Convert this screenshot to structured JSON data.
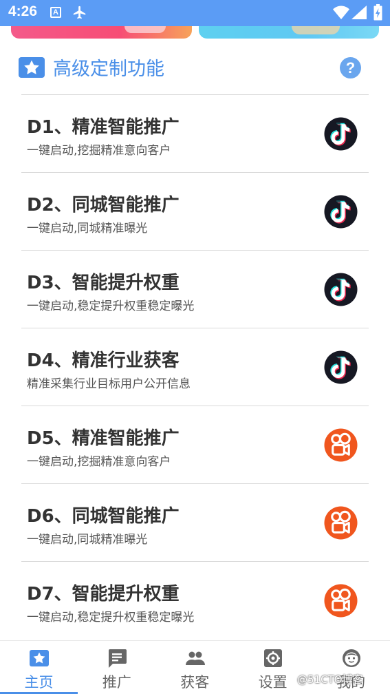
{
  "status_bar": {
    "time": "4:26",
    "a_badge": "A"
  },
  "section": {
    "title": "高级定制功能",
    "help": "?"
  },
  "items": [
    {
      "title": "D1、精准智能推广",
      "subtitle": "一键启动,挖掘精准意向客户",
      "icon": "tiktok-icon"
    },
    {
      "title": "D2、同城智能推广",
      "subtitle": "一键启动,同城精准曝光",
      "icon": "tiktok-icon"
    },
    {
      "title": "D3、智能提升权重",
      "subtitle": "一键启动,稳定提升权重稳定曝光",
      "icon": "tiktok-icon"
    },
    {
      "title": "D4、精准行业获客",
      "subtitle": "精准采集行业目标用户公开信息",
      "icon": "tiktok-icon"
    },
    {
      "title": "D5、精准智能推广",
      "subtitle": "一键启动,挖掘精准意向客户",
      "icon": "kuaishou-icon"
    },
    {
      "title": "D6、同城智能推广",
      "subtitle": "一键启动,同城精准曝光",
      "icon": "kuaishou-icon"
    },
    {
      "title": "D7、智能提升权重",
      "subtitle": "一键启动,稳定提升权重稳定曝光",
      "icon": "kuaishou-icon"
    }
  ],
  "nav": [
    {
      "label": "主页",
      "icon": "star-icon",
      "active": true
    },
    {
      "label": "推广",
      "icon": "message-icon",
      "active": false
    },
    {
      "label": "获客",
      "icon": "people-icon",
      "active": false
    },
    {
      "label": "设置",
      "icon": "gear-icon",
      "active": false
    },
    {
      "label": "我的",
      "icon": "face-icon",
      "active": false
    }
  ],
  "watermark": "@51CTO博客",
  "colors": {
    "accent": "#4a8fe8",
    "status_bar": "#5b9cf5",
    "kuaishou": "#f0561e",
    "tiktok": "#161823"
  }
}
